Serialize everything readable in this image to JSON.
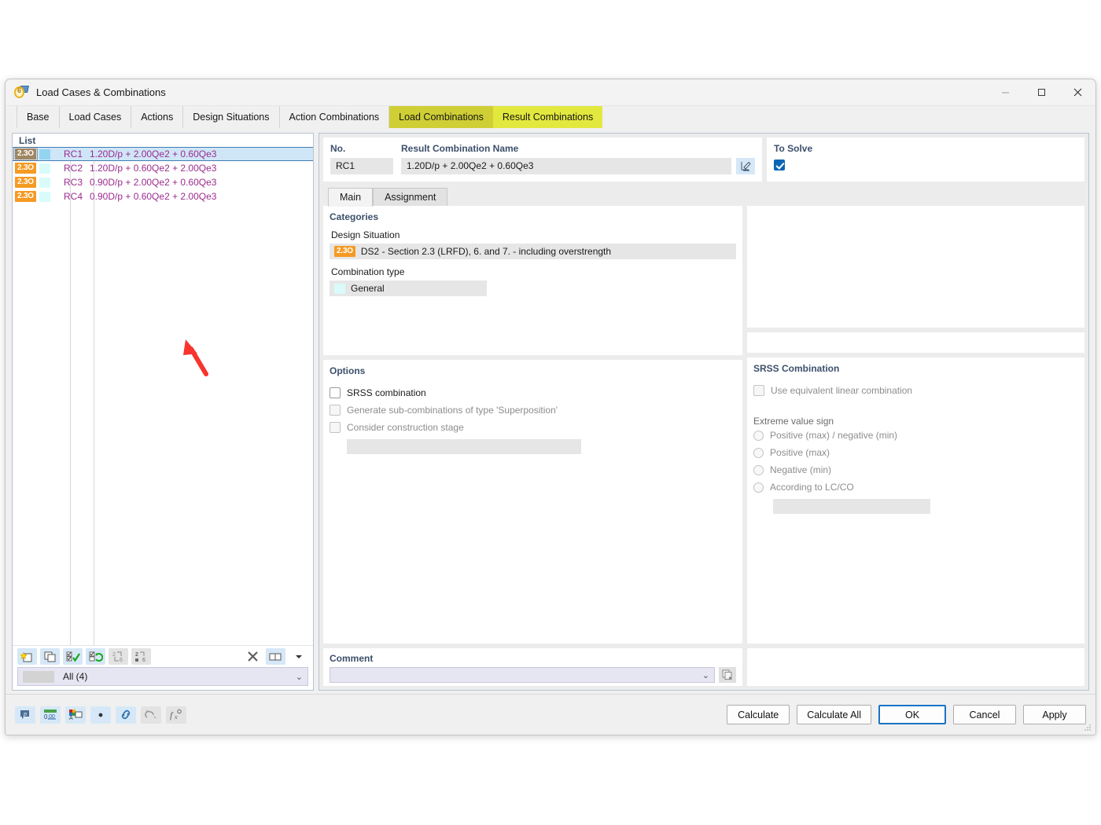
{
  "window": {
    "title": "Load Cases & Combinations",
    "icon": "load-cases-icon",
    "minimize_label": "—",
    "maximize_label": "☐",
    "close_label": "✕"
  },
  "tabs": [
    {
      "label": "Base",
      "state": "normal"
    },
    {
      "label": "Load Cases",
      "state": "normal"
    },
    {
      "label": "Actions",
      "state": "normal"
    },
    {
      "label": "Design Situations",
      "state": "normal"
    },
    {
      "label": "Action Combinations",
      "state": "normal"
    },
    {
      "label": "Load Combinations",
      "state": "highlight-dim"
    },
    {
      "label": "Result Combinations",
      "state": "highlight-bright"
    }
  ],
  "list": {
    "header": "List",
    "rows": [
      {
        "ds": "2.3O",
        "no": "RC1",
        "expr": "1.20D/p + 2.00Qe2 + 0.60Qe3",
        "selected": true
      },
      {
        "ds": "2.3O",
        "no": "RC2",
        "expr": "1.20D/p + 0.60Qe2 + 2.00Qe3",
        "selected": false
      },
      {
        "ds": "2.3O",
        "no": "RC3",
        "expr": "0.90D/p + 2.00Qe2 + 0.60Qe3",
        "selected": false
      },
      {
        "ds": "2.3O",
        "no": "RC4",
        "expr": "0.90D/p + 0.60Qe2 + 2.00Qe3",
        "selected": false
      }
    ],
    "toolbar_icons": [
      "new-item-icon",
      "copy-item-icon",
      "select-all-icon",
      "invert-selection-icon",
      "renumber-icon",
      "sort-icon",
      "delete-icon",
      "view-columns-icon",
      "dropdown-caret-icon"
    ],
    "filter": {
      "label": "All (4)",
      "caret": "⌄"
    }
  },
  "details": {
    "no": {
      "label": "No.",
      "value": "RC1"
    },
    "name": {
      "label": "Result Combination Name",
      "value": "1.20D/p + 2.00Qe2 + 0.60Qe3",
      "edit_icon": "edit-pencil-icon"
    },
    "to_solve": {
      "label": "To Solve",
      "checked": true
    },
    "inner_tabs": [
      {
        "label": "Main",
        "active": true
      },
      {
        "label": "Assignment",
        "active": false
      }
    ],
    "categories": {
      "title": "Categories",
      "design_situation_label": "Design Situation",
      "design_situation_badge": "2.3O",
      "design_situation_value": "DS2 - Section 2.3 (LRFD), 6. and 7. - including overstrength",
      "combination_type_label": "Combination type",
      "combination_type_value": "General"
    },
    "options": {
      "title": "Options",
      "items": [
        {
          "label": "SRSS combination",
          "checked": false,
          "disabled": false
        },
        {
          "label": "Generate sub-combinations of type 'Superposition'",
          "checked": false,
          "disabled": true
        },
        {
          "label": "Consider construction stage",
          "checked": false,
          "disabled": true
        }
      ]
    },
    "srss": {
      "title": "SRSS Combination",
      "use_equivalent_label": "Use equivalent linear combination",
      "use_equivalent_checked": false,
      "extreme_value_label": "Extreme value sign",
      "radios": [
        {
          "label": "Positive (max) / negative (min)",
          "selected": false
        },
        {
          "label": "Positive (max)",
          "selected": false
        },
        {
          "label": "Negative (min)",
          "selected": false
        },
        {
          "label": "According to LC/CO",
          "selected": false
        }
      ]
    },
    "comment": {
      "title": "Comment",
      "value": "",
      "caret": "⌄",
      "copy_icon": "copy-comment-icon"
    }
  },
  "footer": {
    "tool_icons": [
      "info-bubble-icon",
      "units-icon",
      "display-properties-icon",
      "dot-icon",
      "link-icon",
      "snap-icon",
      "formula-icon"
    ],
    "buttons": [
      {
        "label": "Calculate",
        "primary": false
      },
      {
        "label": "Calculate All",
        "primary": false
      },
      {
        "label": "OK",
        "primary": true
      },
      {
        "label": "Cancel",
        "primary": false
      },
      {
        "label": "Apply",
        "primary": false
      }
    ]
  },
  "annotation": {
    "type": "red-arrow",
    "color": "#f8342e"
  },
  "colors": {
    "tab_highlight_bright": "#e3e83e",
    "tab_highlight_dim": "#cfcf35",
    "badge_orange": "#f59a23",
    "list_text_magenta": "#9b2b8e",
    "selection_blue": "#cfe6f7",
    "group_title_blue": "#3c4f6b",
    "accent_blue": "#0a66b5"
  }
}
